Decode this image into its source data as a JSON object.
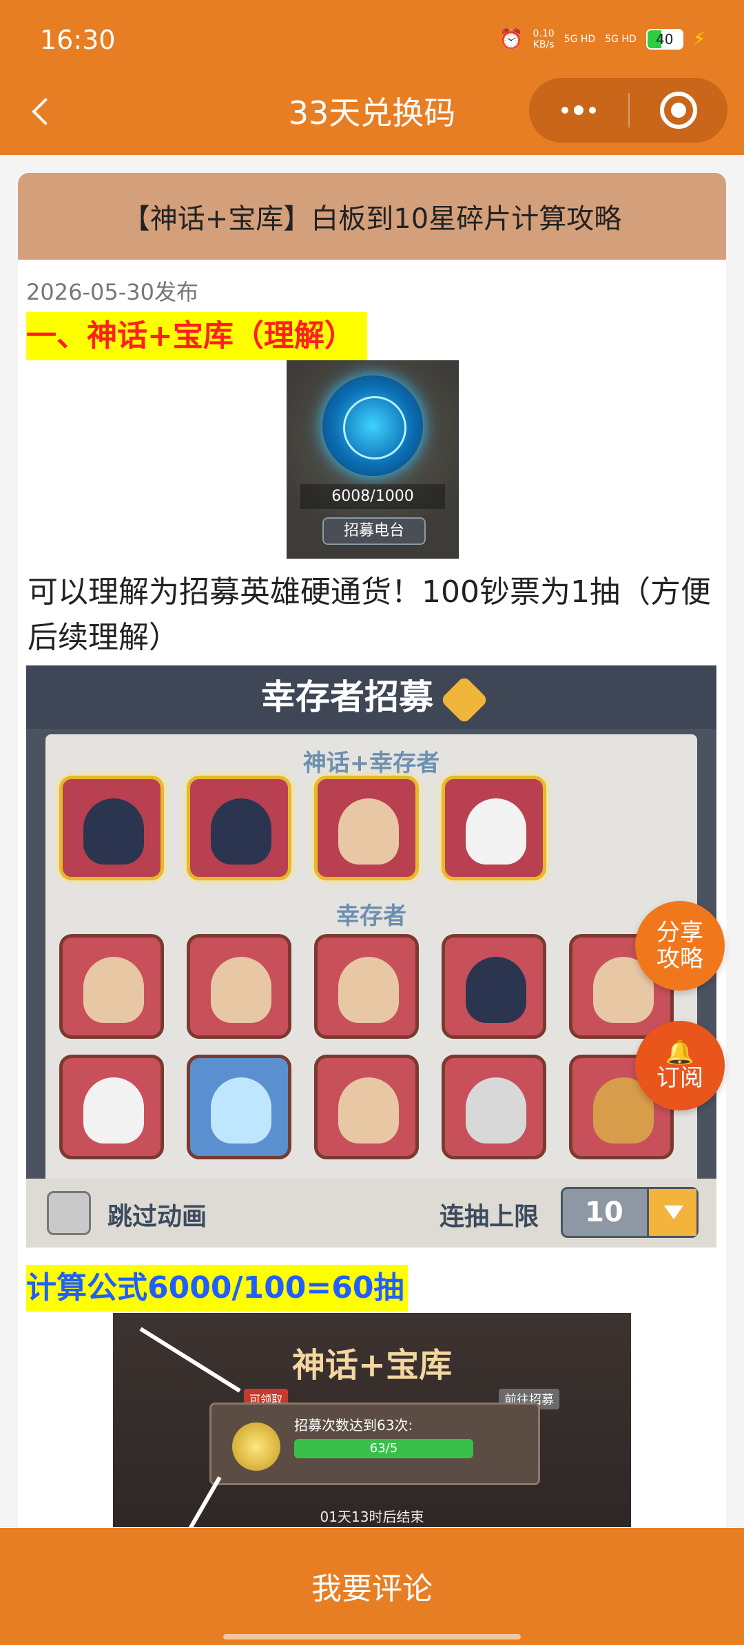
{
  "status_bar": {
    "time": "16:30",
    "net_speed": "0.10",
    "net_unit": "KB/s",
    "signal_1": "5G HD",
    "signal_2": "5G HD",
    "battery": "40",
    "icons": [
      "alarm-icon",
      "signal-icon",
      "battery-icon",
      "charging-icon"
    ]
  },
  "header": {
    "title": "33天兑换码",
    "back_icon": "chevron-left-icon",
    "more_icon": "more-dots-icon",
    "close_icon": "target-close-icon"
  },
  "article": {
    "title": "【神话+宝库】白板到10星碎片计算攻略",
    "date": "2026-05-30发布",
    "section1_heading": "一、神话+宝库（理解）",
    "image1": {
      "count": "6008/1000",
      "button": "招募电台"
    },
    "paragraph1": "可以理解为招募英雄硬通货！100钞票为1抽（方便后续理解）",
    "image2": {
      "banner": "幸存者招募",
      "section_myth": "神话+幸存者",
      "section_normal": "幸存者",
      "skip_label": "跳过动画",
      "limit_label": "连抽上限",
      "limit_value": "10"
    },
    "formula_heading": "计算公式6000/100=60抽",
    "image3": {
      "title": "神话+宝库",
      "claimable": "可领取",
      "goal": "招募次数达到63次:",
      "progress": "63/5",
      "goto": "前往招募",
      "timer": "01天13时后结束"
    }
  },
  "floating": {
    "share": "分享攻略",
    "share_line1": "分享",
    "share_line2": "攻略",
    "subscribe": "订阅",
    "bell": "🔔"
  },
  "footer": {
    "comment": "我要评论"
  },
  "colors": {
    "brand_orange": "#E87E23",
    "card_header": "#D4A07C",
    "highlight_yellow": "#FFFF00",
    "heading_red": "#FF1F1F",
    "heading_blue": "#1F5FFF"
  }
}
